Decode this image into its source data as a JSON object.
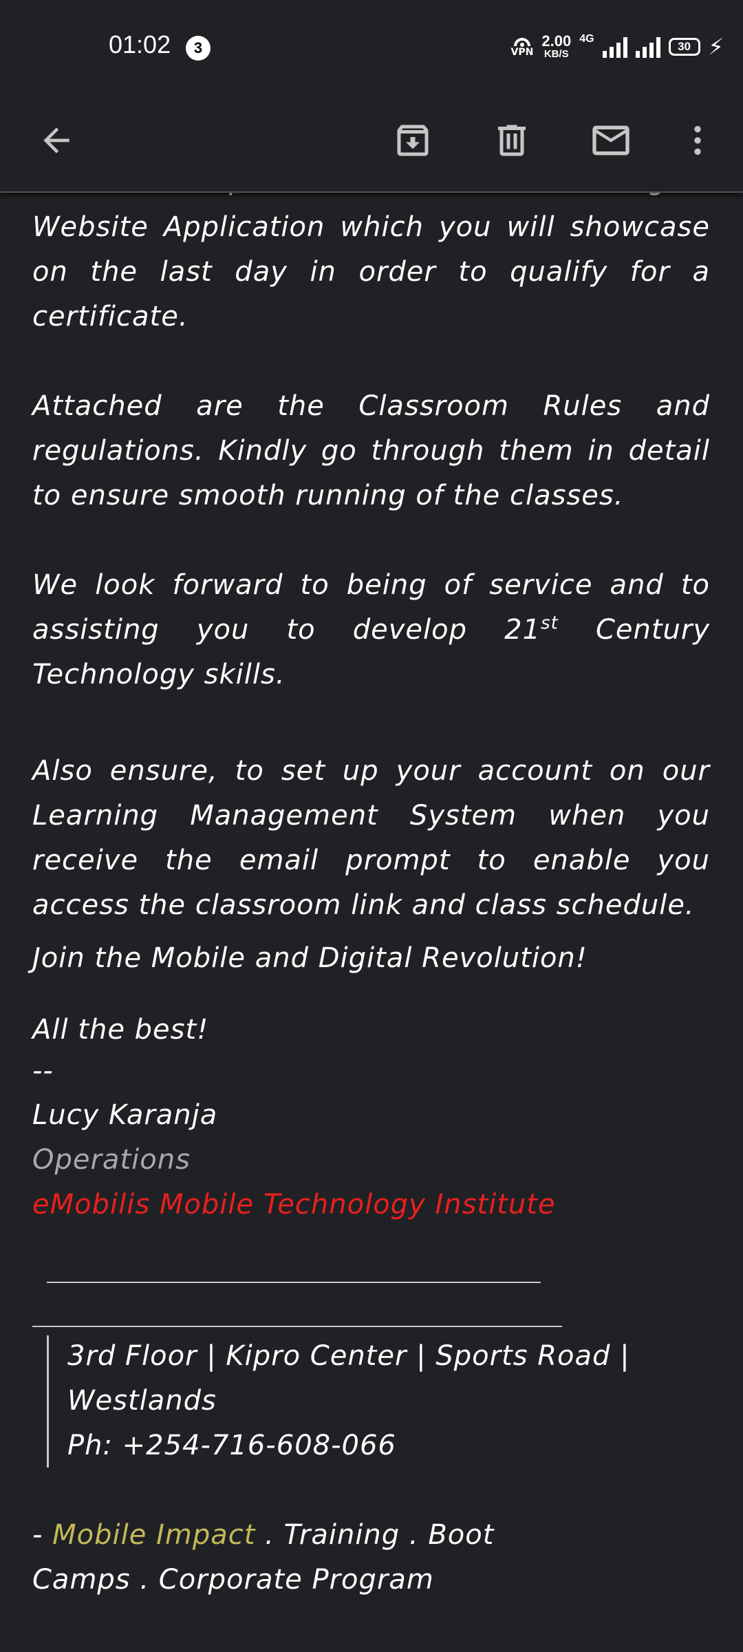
{
  "status_bar": {
    "time": "01:02",
    "notification_count": "3",
    "vpn_label": "VPN",
    "speed_value": "2.00",
    "speed_unit": "KB/S",
    "network_label": "4G",
    "battery_level": "30"
  },
  "toolbar": {
    "icons": [
      "back-arrow-icon",
      "archive-icon",
      "delete-icon",
      "mark-unread-icon",
      "more-vert-icon"
    ]
  },
  "email": {
    "cutoff_line": "You will be expected to create a functioning",
    "p1": "Website Application which you will showcase on the last day in order to qualify for a certificate.",
    "p2": "Attached are the Classroom Rules and regulations. Kindly go through them in detail to ensure smooth running of the classes.",
    "p3_before": "We look forward to being of service and to assisting you to develop 21",
    "p3_sup": "st",
    "p3_after": " Century Technology skills.",
    "p4": "Also ensure, to set up your account on our Learning Management System when you receive the email prompt to enable you access the classroom link and class schedule.",
    "p5": "Join the Mobile and Digital Revolution!",
    "closing": "All the best!",
    "sig_separator": "--",
    "sig_name": "Lucy Karanja",
    "sig_role": "Operations",
    "sig_org": "eMobilis Mobile Technology Institute",
    "address_line1": "3rd Floor | Kipro Center  | Sports Road |",
    "address_line2": "Westlands",
    "phone": "Ph: +254-716-608-066",
    "tagline_dash": "- ",
    "tagline_highlight": "Mobile Impact",
    "tagline_rest1": " . Training . Boot",
    "tagline_rest2": "Camps . Corporate Program"
  },
  "colors": {
    "background": "#202124",
    "text": "#ffffff",
    "role_grey": "#a7a9ad",
    "org_red": "#e8201f",
    "highlight_olive": "#c4b95a"
  }
}
